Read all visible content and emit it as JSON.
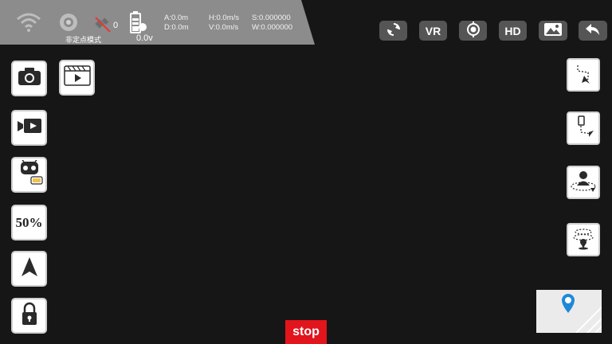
{
  "status": {
    "mode_text": "非定点模式",
    "gps_count": "0",
    "voltage": "0.0v",
    "altitude": "A:0.0m",
    "distance": "D:0.0m",
    "h_speed": "H:0.0m/s",
    "v_speed": "V:0.0m/s",
    "s_value": "S:0.000000",
    "w_value": "W:0.000000"
  },
  "top_toolbar": {
    "vr_label": "VR",
    "hd_label": "HD"
  },
  "left_toolbar": {
    "speed_label": "50%"
  },
  "stop_label": "stop",
  "colors": {
    "status_panel": "#8c8c8c",
    "button_dark": "#555555",
    "stop_red": "#e2141c",
    "map_pin": "#1e88d6"
  }
}
